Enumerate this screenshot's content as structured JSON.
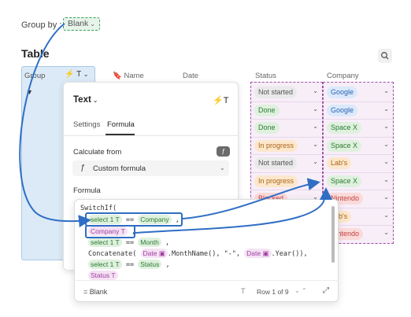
{
  "group_by": {
    "label": "Group by",
    "colon": ":",
    "value": "Blank"
  },
  "table": {
    "title": "Table"
  },
  "columns": {
    "group": "Group",
    "name": "Name",
    "date": "Date",
    "status": "Status",
    "company": "Company"
  },
  "status_cells": [
    {
      "text": "Not started",
      "bg": "#e9e9e9",
      "fg": "#555555"
    },
    {
      "text": "Done",
      "bg": "#dff1de",
      "fg": "#2d7a33"
    },
    {
      "text": "Done",
      "bg": "#dff1de",
      "fg": "#2d7a33"
    },
    {
      "text": "In progress",
      "bg": "#fde7cc",
      "fg": "#a8651a"
    },
    {
      "text": "Not started",
      "bg": "#e9e9e9",
      "fg": "#555555"
    },
    {
      "text": "In progress",
      "bg": "#fde7cc",
      "fg": "#a8651a"
    },
    {
      "text": "Blocked",
      "bg": "#fbdada",
      "fg": "#c24242"
    }
  ],
  "company_cells": [
    {
      "text": "Google",
      "bg": "#dbe9fb",
      "fg": "#2f64b5"
    },
    {
      "text": "Google",
      "bg": "#dbe9fb",
      "fg": "#2f64b5"
    },
    {
      "text": "Space X",
      "bg": "#dff1de",
      "fg": "#2d7a33"
    },
    {
      "text": "Space X",
      "bg": "#dff1de",
      "fg": "#2d7a33"
    },
    {
      "text": "Lab's",
      "bg": "#fde7cc",
      "fg": "#a8651a"
    },
    {
      "text": "Space X",
      "bg": "#dff1de",
      "fg": "#2d7a33"
    },
    {
      "text": "Nintendo",
      "bg": "#fbdada",
      "fg": "#c24242"
    },
    {
      "text": "Lab's",
      "bg": "#fde7cc",
      "fg": "#a8651a"
    },
    {
      "text": "Nintendo",
      "bg": "#fbdada",
      "fg": "#c24242"
    }
  ],
  "popup": {
    "title": "Text",
    "tabs": {
      "settings": "Settings",
      "formula": "Formula"
    },
    "calculate_from": {
      "label": "Calculate from",
      "value": "Custom formula"
    },
    "formula_label": "Formula"
  },
  "editor": {
    "line1": "SwitchIf(",
    "select1": "select 1",
    "eq": "==",
    "company_tok": "Company",
    "comma": ",",
    "company_tok2": "Company",
    "month_tok": "Month",
    "concat": "Concatenate(",
    "date_tok": "Date",
    "month_name": ".MonthName(), \"-\",",
    "year": ".Year()),",
    "status_tok": "Status",
    "result": "= Blank",
    "row_of": "Row 1 of 9"
  },
  "colors": {
    "accent_blue": "#2f6ec4",
    "dashed_purple": "#a14fa7",
    "dashed_green": "#3f9b5a"
  }
}
